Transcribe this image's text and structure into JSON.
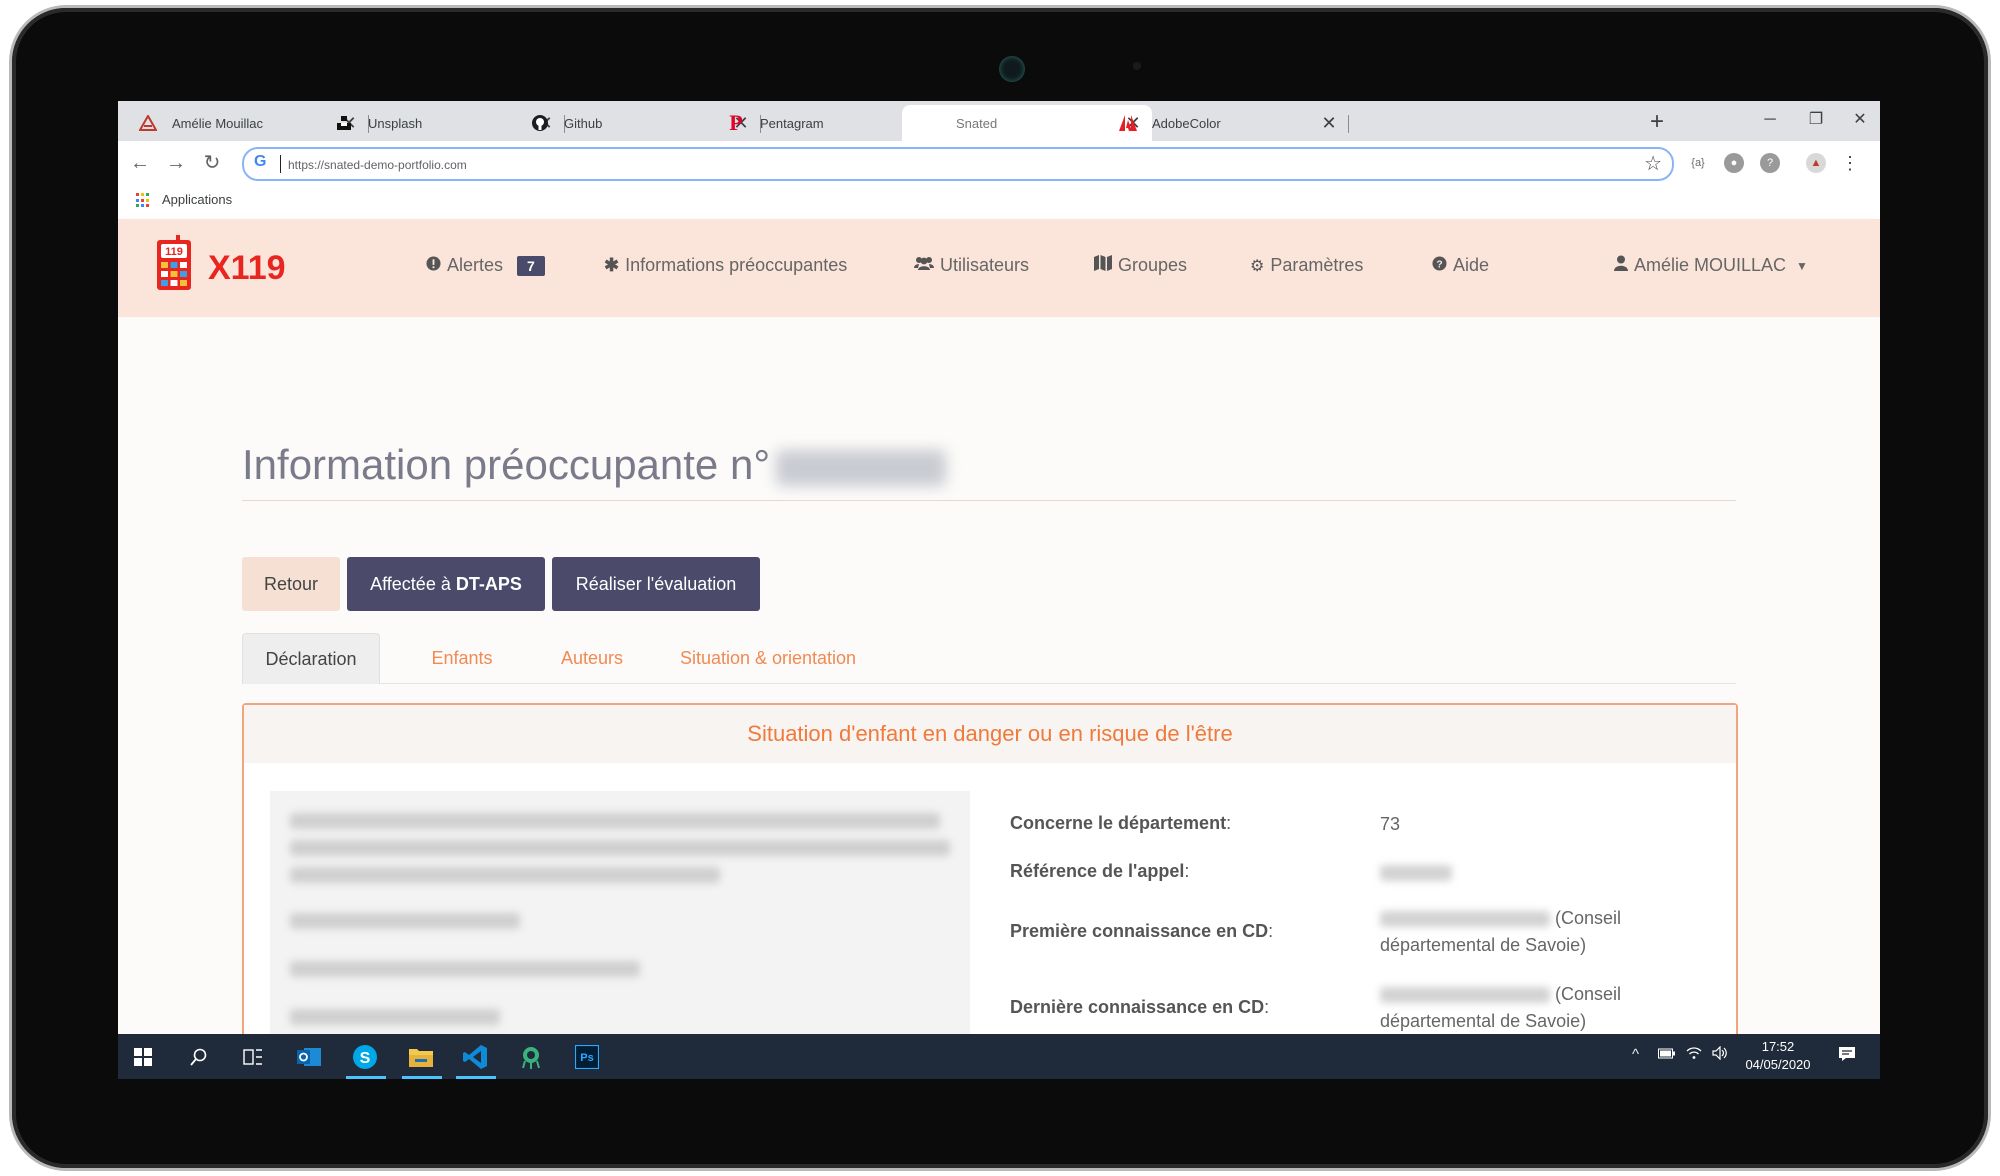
{
  "browser": {
    "tabs": [
      {
        "title": "Amélie Mouillac",
        "icon": "amelie-logo-icon"
      },
      {
        "title": "Unsplash",
        "icon": "unsplash-icon"
      },
      {
        "title": "Github",
        "icon": "github-icon"
      },
      {
        "title": "Pentagram",
        "icon": "pentagram-icon"
      },
      {
        "title": "Snated",
        "icon": "none"
      },
      {
        "title": "AdobeColor",
        "icon": "adobe-icon"
      }
    ],
    "active_tab": 4,
    "url": "https://snated-demo-portfolio.com",
    "bookmark_apps": "Applications",
    "new_tab": "+"
  },
  "app": {
    "logo_text": "X119",
    "logo_badge": "119",
    "nav": {
      "alertes": "Alertes",
      "alertes_count": "7",
      "informations": "Informations préoccupantes",
      "utilisateurs": "Utilisateurs",
      "groupes": "Groupes",
      "parametres": "Paramètres",
      "aide": "Aide",
      "user": "Amélie MOUILLAC"
    },
    "colors": {
      "navbar_bg": "#fbe5da",
      "accent": "#f07a3c",
      "dark_button": "#4b4a6b",
      "logo_red": "#e8251f"
    }
  },
  "page": {
    "title": "Information préoccupante n°",
    "buttons": {
      "retour": "Retour",
      "affectee_prefix": "Affectée à",
      "affectee_target": "DT-APS",
      "evaluation": "Réaliser l'évaluation"
    },
    "tabs": [
      "Déclaration",
      "Enfants",
      "Auteurs",
      "Situation & orientation"
    ],
    "panel": {
      "title": "Situation d'enfant en danger ou en risque de l'être",
      "fields": {
        "departement_label": "Concerne le département",
        "departement_value": "73",
        "reference_label": "Référence de l'appel",
        "premiere_label": "Première connaissance en CD",
        "premiere_suffix": "(Conseil",
        "premiere_suffix2": "départemental de Savoie)",
        "derniere_label": "Dernière connaissance en CD",
        "derniere_suffix": "(Conseil",
        "derniere_suffix2": "départemental de Savoie)",
        "colon": ":"
      }
    }
  },
  "taskbar": {
    "time": "17:52",
    "date": "04/05/2020"
  }
}
